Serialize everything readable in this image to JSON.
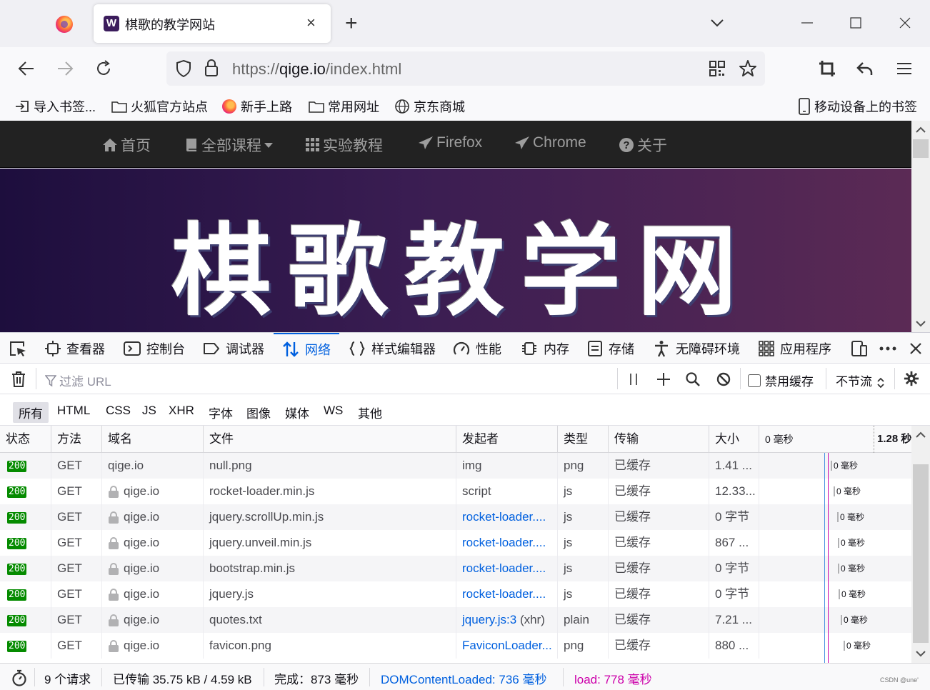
{
  "window": {
    "tab_title": "棋歌的教学网站",
    "tab_favicon_letter": "W",
    "new_tab": "+",
    "close_tab": "×"
  },
  "navbar": {
    "url_scheme": "https://",
    "url_host": "qige.io",
    "url_path": "/index.html"
  },
  "bookmarks": {
    "items": [
      "导入书签...",
      "火狐官方站点",
      "新手上路",
      "常用网址",
      "京东商城"
    ],
    "mobile": "移动设备上的书签"
  },
  "site": {
    "nav": [
      "首页",
      "全部课程",
      "实验教程",
      "Firefox",
      "Chrome",
      "关于"
    ],
    "hero_title": "棋歌教学网"
  },
  "devtools": {
    "tabs": [
      "查看器",
      "控制台",
      "调试器",
      "网络",
      "样式编辑器",
      "性能",
      "内存",
      "存储",
      "无障碍环境",
      "应用程序"
    ],
    "active_tab": "网络",
    "filter_placeholder": "过滤 URL",
    "disable_cache": "禁用缓存",
    "throttle": "不节流",
    "types": [
      "所有",
      "HTML",
      "CSS",
      "JS",
      "XHR",
      "字体",
      "图像",
      "媒体",
      "WS",
      "其他"
    ],
    "active_type": "所有",
    "columns": [
      "状态",
      "方法",
      "域名",
      "文件",
      "发起者",
      "类型",
      "传输",
      "大小",
      "0 毫秒",
      "1.28 秒"
    ],
    "rows": [
      {
        "status": "200",
        "method": "GET",
        "domain": "qige.io",
        "file": "null.png",
        "initiator": "img",
        "type": "png",
        "transfer": "已缓存",
        "size": "1.41 ...",
        "wf": "0 毫秒"
      },
      {
        "status": "200",
        "method": "GET",
        "domain": "qige.io",
        "file": "rocket-loader.min.js",
        "initiator": "script",
        "type": "js",
        "transfer": "已缓存",
        "size": "12.33...",
        "wf": "0 毫秒"
      },
      {
        "status": "200",
        "method": "GET",
        "domain": "qige.io",
        "file": "jquery.scrollUp.min.js",
        "initiator": "rocket-loader....",
        "type": "js",
        "transfer": "已缓存",
        "size": "0 字节",
        "wf": "0 毫秒"
      },
      {
        "status": "200",
        "method": "GET",
        "domain": "qige.io",
        "file": "jquery.unveil.min.js",
        "initiator": "rocket-loader....",
        "type": "js",
        "transfer": "已缓存",
        "size": "867 ...",
        "wf": "0 毫秒"
      },
      {
        "status": "200",
        "method": "GET",
        "domain": "qige.io",
        "file": "bootstrap.min.js",
        "initiator": "rocket-loader....",
        "type": "js",
        "transfer": "已缓存",
        "size": "0 字节",
        "wf": "0 毫秒"
      },
      {
        "status": "200",
        "method": "GET",
        "domain": "qige.io",
        "file": "jquery.js",
        "initiator": "rocket-loader....",
        "type": "js",
        "transfer": "已缓存",
        "size": "0 字节",
        "wf": "0 毫秒"
      },
      {
        "status": "200",
        "method": "GET",
        "domain": "qige.io",
        "file": "quotes.txt",
        "initiator": "jquery.js:3",
        "initiator_extra": " (xhr)",
        "type": "plain",
        "transfer": "已缓存",
        "size": "7.21 ...",
        "wf": "0 毫秒"
      },
      {
        "status": "200",
        "method": "GET",
        "domain": "qige.io",
        "file": "favicon.png",
        "initiator": "FaviconLoader...",
        "type": "png",
        "transfer": "已缓存",
        "size": "880 ...",
        "wf": "0 毫秒"
      }
    ],
    "statusbar": {
      "requests": "9 个请求",
      "transferred": "已传输 35.75 kB / 4.59 kB",
      "finish": "完成：873 毫秒",
      "dcl": "DOMContentLoaded: 736 毫秒",
      "load": "load: 778 毫秒"
    }
  },
  "watermark": "CSDN @une'",
  "colors": {
    "accent": "#0060df",
    "status_ok": "#058b00",
    "load_line": "#cc00aa"
  }
}
